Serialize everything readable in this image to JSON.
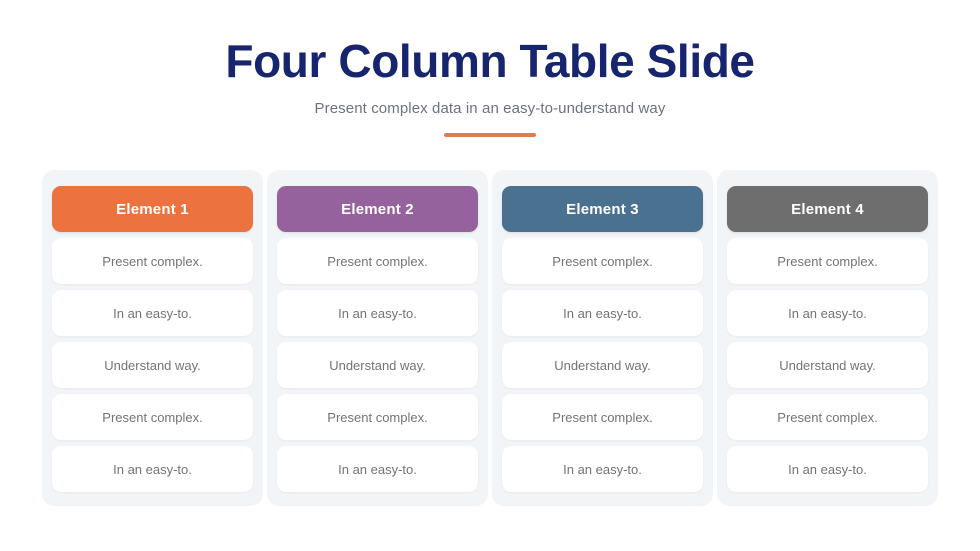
{
  "header": {
    "title": "Four Column Table Slide",
    "subtitle": "Present complex data in an easy-to-understand way",
    "title_color": "#17256E",
    "subtitle_color": "#6B7280",
    "accent_bar_color": "#E07B52"
  },
  "theme": {
    "page_background": "#FFFFFF",
    "card_background": "#F2F5F8",
    "cell_background": "#FFFFFF",
    "cell_text_color": "#707479"
  },
  "table": {
    "columns": [
      {
        "header": "Element 1",
        "header_color": "#EC7240",
        "cells": [
          "Present complex.",
          "In an easy-to.",
          "Understand way.",
          "Present complex.",
          "In an easy-to."
        ]
      },
      {
        "header": "Element 2",
        "header_color": "#96629E",
        "cells": [
          "Present complex.",
          "In an easy-to.",
          "Understand way.",
          "Present complex.",
          "In an easy-to."
        ]
      },
      {
        "header": "Element 3",
        "header_color": "#4B7191",
        "cells": [
          "Present complex.",
          "In an easy-to.",
          "Understand way.",
          "Present complex.",
          "In an easy-to."
        ]
      },
      {
        "header": "Element 4",
        "header_color": "#6E6E6E",
        "cells": [
          "Present complex.",
          "In an easy-to.",
          "Understand way.",
          "Present complex.",
          "In an easy-to."
        ]
      }
    ]
  }
}
